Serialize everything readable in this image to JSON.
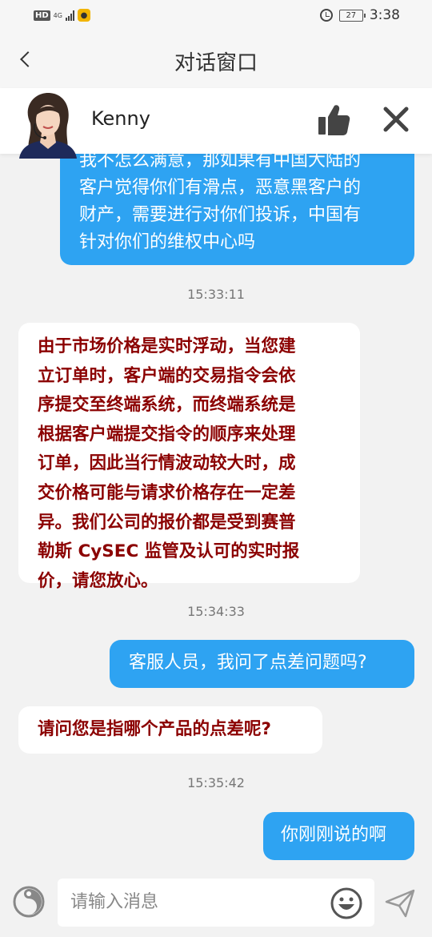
{
  "status": {
    "time": "3:38",
    "battery": "27",
    "hd": "HD",
    "network": "4G"
  },
  "header": {
    "title": "对话窗口",
    "back_icon": "chevron-left-icon"
  },
  "agent": {
    "name": "Kenny",
    "like_icon": "thumbs-up-icon",
    "close_icon": "close-icon"
  },
  "messages": [
    {
      "from": "me",
      "lines": [
        "我不怎么满意，那如果有中国大陆的",
        "客户觉得你们有滑点，恶意黑客户的",
        "财产，需要进行对你们投诉，中国有",
        "针对你们的维权中心吗"
      ]
    },
    {
      "from": "agent",
      "time": "15:33:11",
      "lines": [
        "由于市场价格是实时浮动，当您建",
        "立订单时，客户端的交易指令会依",
        "序提交至终端系统，而终端系统是",
        "根据客户端提交指令的顺序来处理",
        "订单，因此当行情波动较大时，成",
        "交价格可能与请求价格存在一定差",
        "异。我们公司的报价都是受到赛普",
        "勒斯 CySEC 监管及认可的实时报",
        "价，请您放心。"
      ]
    },
    {
      "from": "me",
      "time": "15:34:33",
      "lines": [
        "客服人员，我问了点差问题吗?"
      ]
    },
    {
      "from": "agent",
      "lines": [
        "请问您是指哪个产品的点差呢?"
      ]
    },
    {
      "from": "me",
      "time": "15:35:42",
      "lines": [
        "你刚刚说的啊"
      ]
    }
  ],
  "input": {
    "placeholder": "请输入消息",
    "voice_icon": "voice-icon",
    "emoji_icon": "emoji-icon",
    "send_icon": "send-icon"
  },
  "colors": {
    "user_bubble": "#2ea3f2",
    "agent_text": "#8b0000",
    "background": "#f2f2f2"
  }
}
